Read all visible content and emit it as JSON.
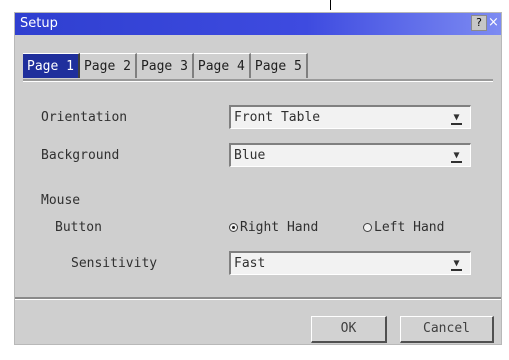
{
  "window": {
    "title": "Setup",
    "help_label": "?",
    "close_label": "×"
  },
  "tabs": [
    {
      "label": "Page 1",
      "active": true
    },
    {
      "label": "Page 2",
      "active": false
    },
    {
      "label": "Page 3",
      "active": false
    },
    {
      "label": "Page 4",
      "active": false
    },
    {
      "label": "Page 5",
      "active": false
    }
  ],
  "form": {
    "orientation": {
      "label": "Orientation",
      "value": "Front Table"
    },
    "background": {
      "label": "Background",
      "value": "Blue"
    },
    "mouse": {
      "label": "Mouse",
      "button_label": "Button",
      "right_hand": "Right Hand",
      "left_hand": "Left Hand",
      "selected": "Right Hand",
      "sensitivity_label": "Sensitivity",
      "sensitivity_value": "Fast"
    }
  },
  "buttons": {
    "ok": "OK",
    "cancel": "Cancel"
  },
  "icons": {
    "dropdown": "dropdown-arrow-icon",
    "help": "help-icon",
    "close": "close-icon"
  },
  "colors": {
    "titlebar": "#3e4be0",
    "active_tab": "#1f2f9c",
    "dialog_bg": "#cfcfcf"
  }
}
